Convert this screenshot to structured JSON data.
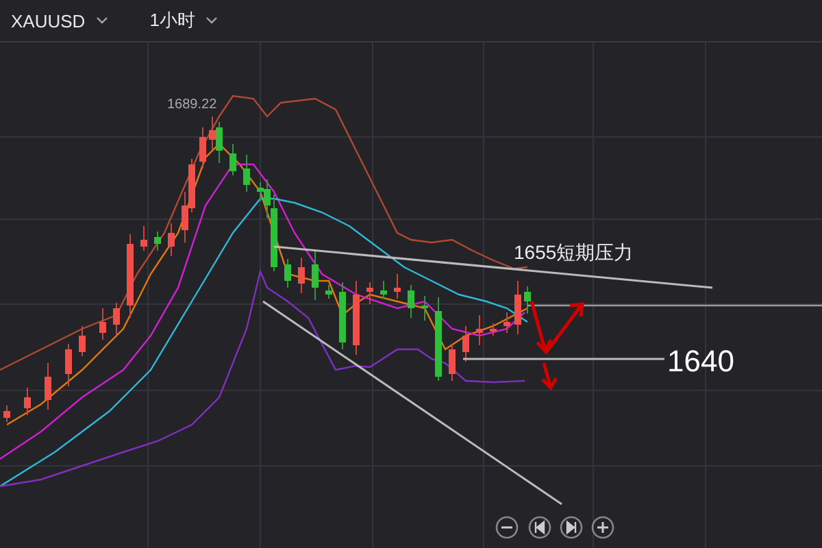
{
  "toolbar": {
    "symbol": "XAUUSD",
    "timeframe": "1小时"
  },
  "chart": {
    "high_label": "1689.22",
    "annotations": [
      {
        "kind": "resistance",
        "label": "1655短期压力"
      },
      {
        "kind": "support",
        "label": "1640"
      }
    ]
  }
}
